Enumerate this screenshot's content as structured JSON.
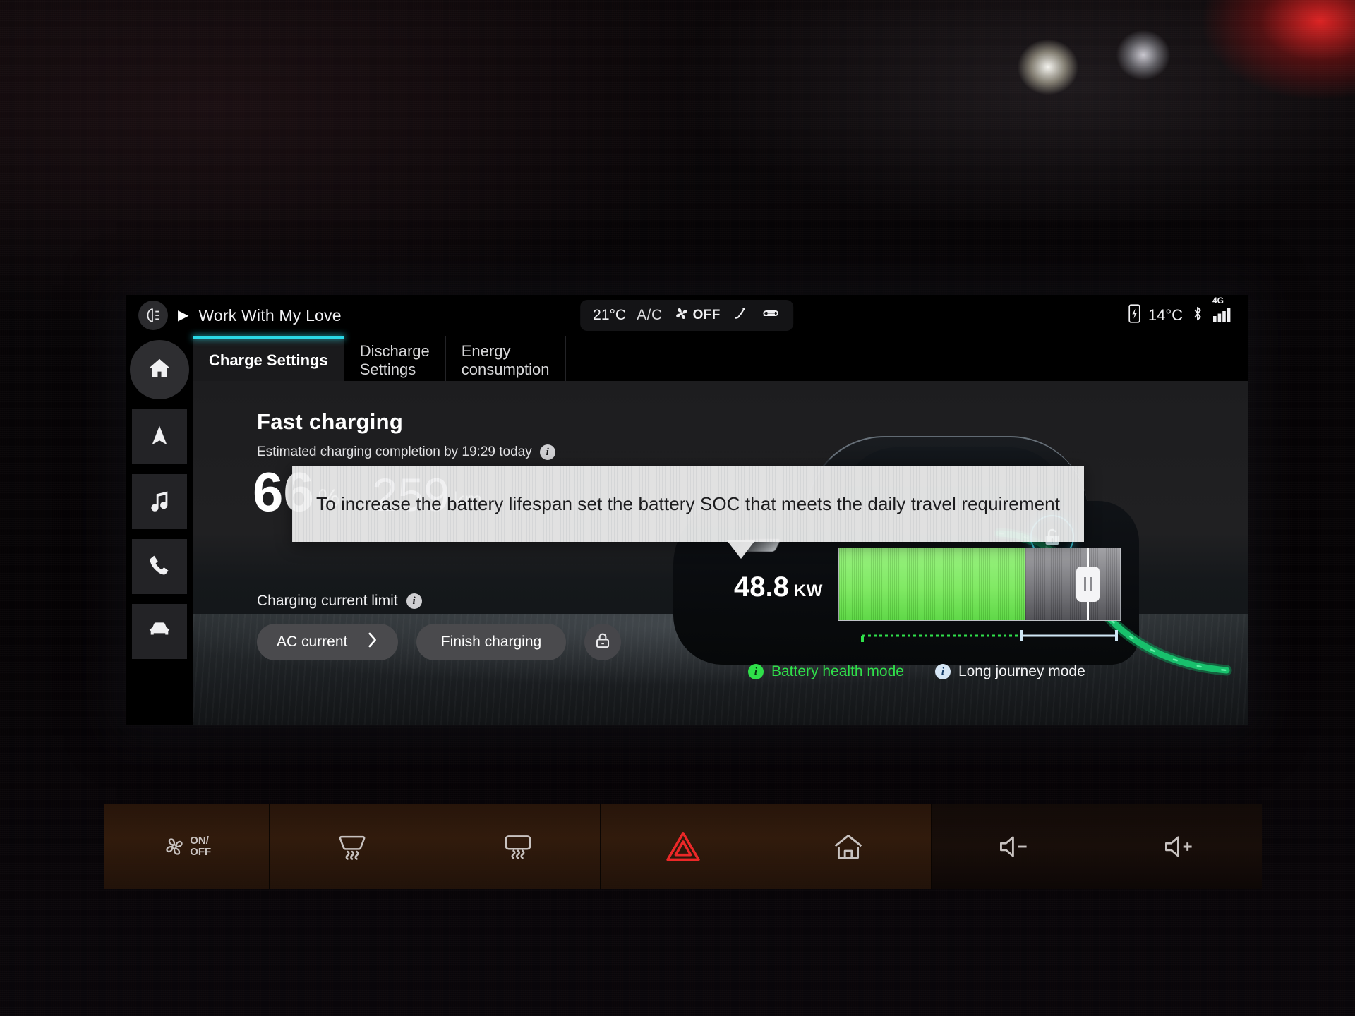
{
  "statusbar": {
    "media_icon": "headlight-icon",
    "play_icon": "play-icon",
    "media_title": "Work With My Love",
    "climate": {
      "temperature": "21°C",
      "ac_label": "A/C",
      "fan_state": "OFF",
      "fan_icon": "fan-icon",
      "seat_icon": "seat-heat-icon",
      "defog_icon": "rear-defog-icon"
    },
    "system": {
      "battery_icon": "battery-charging-icon",
      "outside_temp": "14°C",
      "bluetooth_icon": "bluetooth-icon",
      "network_label": "4G",
      "signal_icon": "signal-bars-icon"
    }
  },
  "sidebar": {
    "items": [
      {
        "name": "home",
        "icon": "home-icon"
      },
      {
        "name": "navigation",
        "icon": "navigation-arrow-icon"
      },
      {
        "name": "media",
        "icon": "music-note-icon"
      },
      {
        "name": "phone",
        "icon": "phone-icon"
      },
      {
        "name": "vehicle",
        "icon": "car-icon"
      }
    ]
  },
  "tabs": [
    {
      "label": "Charge Settings",
      "active": true
    },
    {
      "label": "Discharge\nSettings",
      "active": false
    },
    {
      "label": "Energy\nconsumption",
      "active": false
    }
  ],
  "charging": {
    "title": "Fast charging",
    "estimate": "Estimated charging completion by 19:29 today",
    "estimate_info_icon": "info-icon",
    "soc_value": "66",
    "soc_unit": "%",
    "range_value": "259",
    "range_unit": "km",
    "power_value": "48.8",
    "power_unit": "KW",
    "battery_percent": 66,
    "target_percent": 88,
    "limit_label": "Charging current limit",
    "limit_info_icon": "info-icon",
    "buttons": {
      "ac_current": "AC current",
      "ac_current_chevron": "chevron-right-icon",
      "finish_charging": "Finish charging",
      "lock_icon": "charge-lock-icon"
    },
    "unlock_icon": "unlock-icon",
    "legend": [
      {
        "label": "Battery health mode",
        "icon": "info-icon",
        "color": "#2fe04a"
      },
      {
        "label": "Long journey mode",
        "icon": "info-icon",
        "color": "#f2f2f4"
      }
    ]
  },
  "tooltip": {
    "text": "To increase the battery lifespan set the battery SOC that meets the daily travel requirement"
  },
  "console_buttons": [
    {
      "name": "fan-onoff",
      "icon": "fan-onoff-icon",
      "label_top": "ON/",
      "label_bottom": "OFF"
    },
    {
      "name": "front-defrost",
      "icon": "front-defrost-icon"
    },
    {
      "name": "rear-defrost",
      "icon": "rear-defrost-icon"
    },
    {
      "name": "hazard",
      "icon": "hazard-triangle-icon"
    },
    {
      "name": "home",
      "icon": "home-outline-icon"
    },
    {
      "name": "volume-down",
      "icon": "volume-down-icon"
    },
    {
      "name": "volume-up",
      "icon": "volume-up-icon"
    }
  ],
  "colors": {
    "accent_cyan": "#2ad8e6",
    "battery_green": "#7ae85c",
    "health_green": "#2fe04a",
    "hazard_red": "#ff2b2b"
  }
}
